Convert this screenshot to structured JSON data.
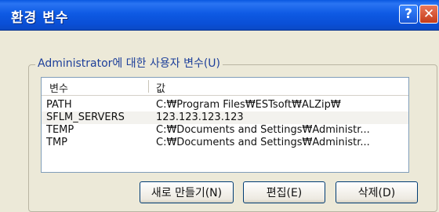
{
  "window": {
    "title": "환경 변수",
    "help_label": "?",
    "close_label": "✕"
  },
  "user_vars": {
    "group_label": "Administrator에 대한 사용자 변수(U)",
    "columns": [
      "변수",
      "값"
    ],
    "rows": [
      {
        "name": "PATH",
        "value": "C:₩Program Files₩ESTsoft₩ALZip₩"
      },
      {
        "name": "SFLM_SERVERS",
        "value": "123.123.123.123"
      },
      {
        "name": "TEMP",
        "value": "C:₩Documents and Settings₩Administr..."
      },
      {
        "name": "TMP",
        "value": "C:₩Documents and Settings₩Administr..."
      }
    ],
    "buttons": {
      "new": "새로 만들기(N)",
      "edit": "편집(E)",
      "delete": "삭제(D)"
    }
  }
}
